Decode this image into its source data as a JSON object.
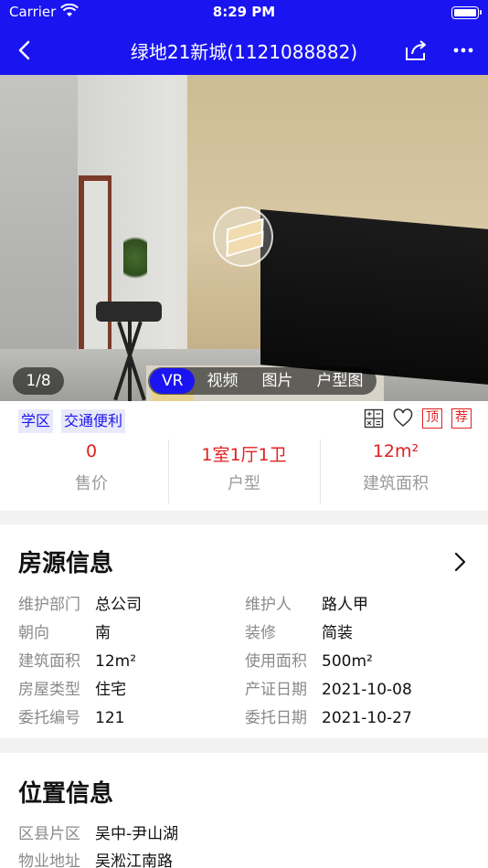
{
  "status": {
    "carrier": "Carrier",
    "time": "8:29 PM"
  },
  "nav": {
    "title": "绿地21新城(1121088882)"
  },
  "media": {
    "counter": "1/8",
    "tabs": [
      "VR",
      "视频",
      "图片",
      "户型图"
    ],
    "active_tab": "VR"
  },
  "tags": [
    "学区",
    "交通便利"
  ],
  "marks": {
    "top": "顶",
    "recommend": "荐"
  },
  "stats": [
    {
      "value": "0",
      "label": "售价"
    },
    {
      "value": "1室1厅1卫",
      "label": "户型"
    },
    {
      "value": "12m²",
      "label": "建筑面积"
    }
  ],
  "listing": {
    "title": "房源信息",
    "rows": [
      {
        "k1": "维护部门",
        "v1": "总公司",
        "k2": "维护人",
        "v2": "路人甲"
      },
      {
        "k1": "朝向",
        "v1": "南",
        "k2": "装修",
        "v2": "简装"
      },
      {
        "k1": "建筑面积",
        "v1": "12m²",
        "k2": "使用面积",
        "v2": "500m²"
      },
      {
        "k1": "房屋类型",
        "v1": "住宅",
        "k2": "产证日期",
        "v2": "2021-10-08"
      },
      {
        "k1": "委托编号",
        "v1": "121",
        "k2": "委托日期",
        "v2": "2021-10-27"
      }
    ]
  },
  "location": {
    "title": "位置信息",
    "rows": [
      {
        "k": "区县片区",
        "v": "吴中-尹山湖"
      },
      {
        "k": "物业地址",
        "v": "吴淞江南路"
      }
    ]
  }
}
